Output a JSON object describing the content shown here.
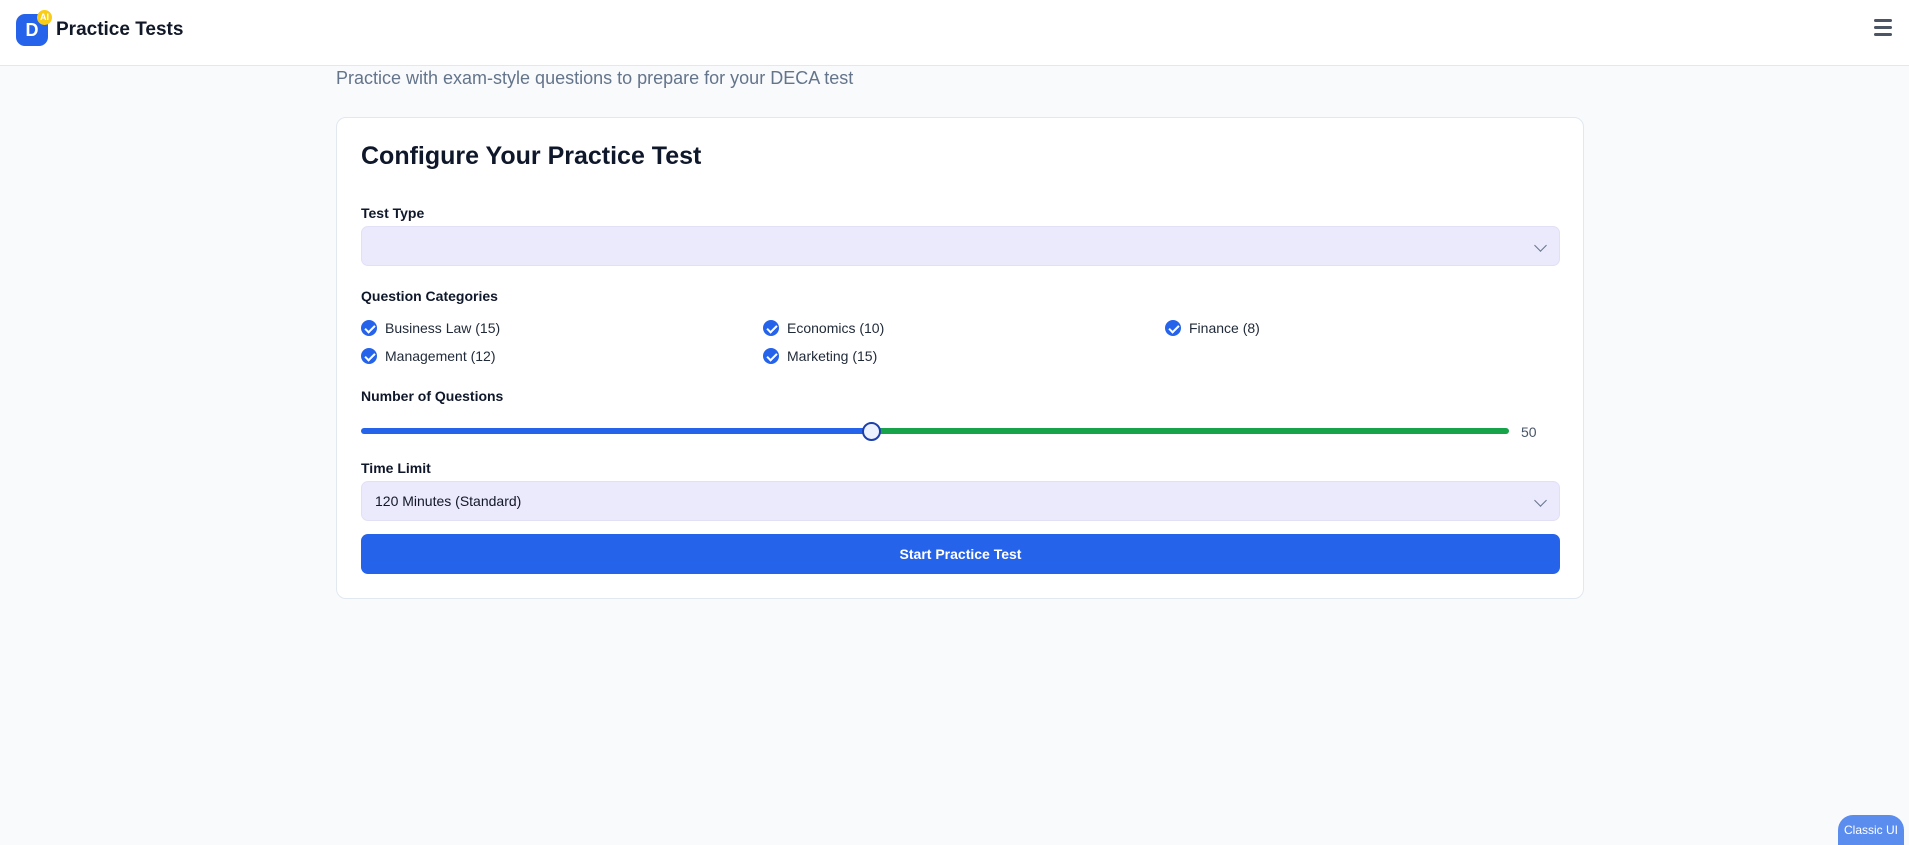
{
  "header": {
    "logo_letter": "D",
    "logo_badge": "AI",
    "title": "Practice Tests",
    "menu_icon": "hamburger-menu-icon"
  },
  "subtitle": "Practice with exam-style questions to prepare for your DECA test",
  "card": {
    "title": "Configure Your Practice Test",
    "test_type": {
      "label": "Test Type",
      "value": ""
    },
    "categories": {
      "label": "Question Categories",
      "items": [
        {
          "label": "Business Law (15)",
          "checked": true
        },
        {
          "label": "Economics (10)",
          "checked": true
        },
        {
          "label": "Finance (8)",
          "checked": true
        },
        {
          "label": "Management (12)",
          "checked": true
        },
        {
          "label": "Marketing (15)",
          "checked": true
        }
      ]
    },
    "num_questions": {
      "label": "Number of Questions",
      "value": "50",
      "fraction": 0.444
    },
    "time_limit": {
      "label": "Time Limit",
      "value": "120 Minutes (Standard)"
    },
    "start_button": "Start Practice Test"
  },
  "classic_ui_button": "Classic UI",
  "colors": {
    "primary": "#2563eb",
    "slider_rest": "#16a34a",
    "select_bg": "#ebe9fc",
    "page_bg": "#f8fafc"
  }
}
